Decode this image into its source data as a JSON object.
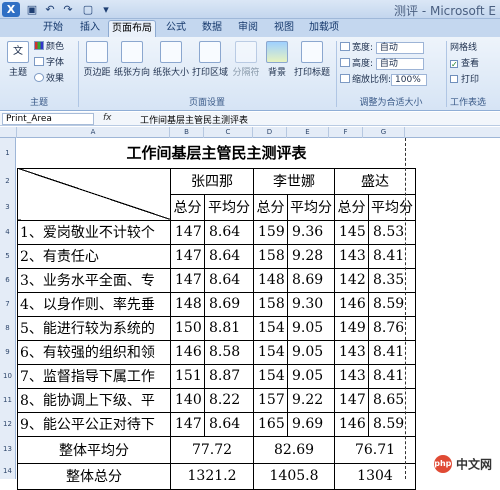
{
  "window": {
    "title": "测评 - Microsoft E"
  },
  "tabs": [
    "开始",
    "插入",
    "页面布局",
    "公式",
    "数据",
    "审阅",
    "视图",
    "加载项"
  ],
  "active_tab": 2,
  "ribbon": {
    "theme_group": {
      "label": "主题",
      "main": "主题",
      "colors": "颜色",
      "fonts": "字体",
      "effects": "效果"
    },
    "page_setup_group": {
      "label": "页面设置",
      "buttons": [
        "页边距",
        "纸张方向",
        "纸张大小",
        "打印区域",
        "分隔符",
        "背景",
        "打印标题"
      ]
    },
    "scale_group": {
      "label": "调整为合适大小",
      "width_label": "宽度:",
      "width_value": "自动",
      "height_label": "高度:",
      "height_value": "自动",
      "scale_label": "缩放比例:",
      "scale_value": "100%"
    },
    "sheet_options_group": {
      "label": "工作表选",
      "gridlines": "网格线",
      "view": "查看",
      "print": "打印"
    }
  },
  "formula_bar": {
    "name_box": "Print_Area",
    "fx": "fx",
    "value": "工作间基层主管民主测评表"
  },
  "columns": [
    "A",
    "B",
    "C",
    "D",
    "E",
    "F",
    "G"
  ],
  "rows": [
    "1",
    "2",
    "3",
    "4",
    "5",
    "6",
    "7",
    "8",
    "9",
    "10",
    "11",
    "12",
    "13",
    "14"
  ],
  "sheet": {
    "title": "工作间基层主管民主测评表",
    "persons": [
      "张四那",
      "李世娜",
      "盛达"
    ],
    "subheaders": [
      "总分",
      "平均分"
    ],
    "items": [
      {
        "label": "1、爱岗敬业不计较个",
        "v": [
          "147",
          "8.64",
          "159",
          "9.36",
          "145",
          "8.53"
        ]
      },
      {
        "label": "2、有责任心",
        "v": [
          "147",
          "8.64",
          "158",
          "9.28",
          "143",
          "8.41"
        ]
      },
      {
        "label": "3、业务水平全面、专",
        "v": [
          "147",
          "8.64",
          "148",
          "8.69",
          "142",
          "8.35"
        ]
      },
      {
        "label": "4、以身作则、率先垂",
        "v": [
          "148",
          "8.69",
          "158",
          "9.30",
          "146",
          "8.59"
        ]
      },
      {
        "label": "5、能进行较为系统的",
        "v": [
          "150",
          "8.81",
          "154",
          "9.05",
          "149",
          "8.76"
        ]
      },
      {
        "label": "6、有较强的组织和领",
        "v": [
          "146",
          "8.58",
          "154",
          "9.05",
          "143",
          "8.41"
        ]
      },
      {
        "label": "7、监督指导下属工作",
        "v": [
          "151",
          "8.87",
          "154",
          "9.05",
          "143",
          "8.41"
        ]
      },
      {
        "label": "8、能协调上下级、平",
        "v": [
          "140",
          "8.22",
          "157",
          "9.22",
          "147",
          "8.65"
        ]
      },
      {
        "label": "9、能公平公正对待下",
        "v": [
          "147",
          "8.64",
          "165",
          "9.69",
          "146",
          "8.59"
        ]
      }
    ],
    "overall_avg": {
      "label": "整体平均分",
      "values": [
        "77.72",
        "82.69",
        "76.71"
      ]
    },
    "overall_total": {
      "label": "整体总分",
      "values": [
        "1321.2",
        "1405.8",
        "1304"
      ]
    }
  },
  "watermark": {
    "badge": "php",
    "text": "中文网"
  }
}
